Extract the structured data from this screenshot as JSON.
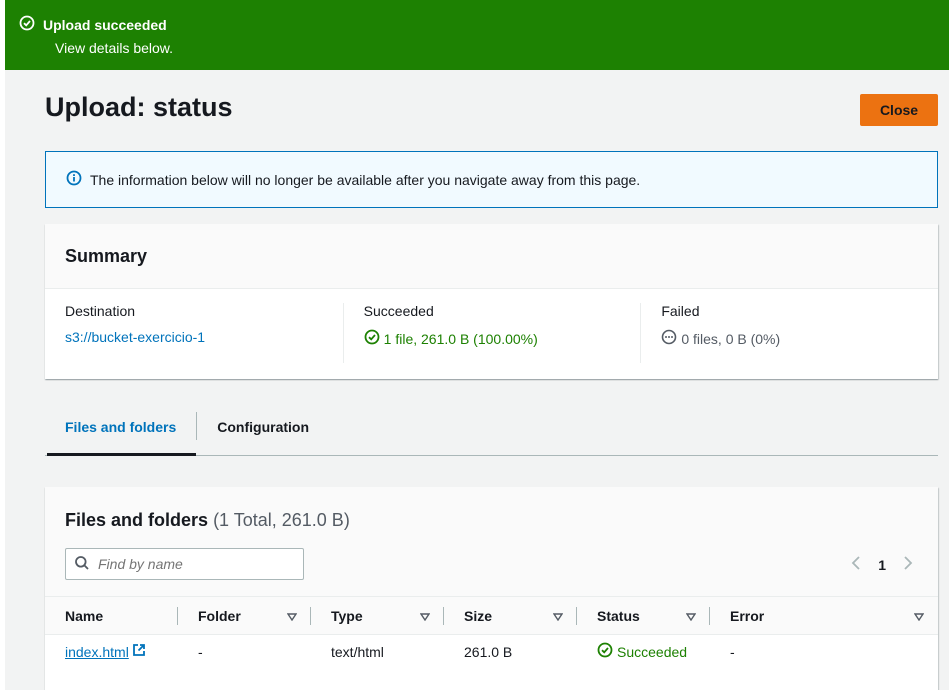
{
  "flash": {
    "title": "Upload succeeded",
    "subtitle": "View details below.",
    "color": "#1d8102"
  },
  "page": {
    "title": "Upload: status",
    "close_label": "Close"
  },
  "info_alert": {
    "text": "The information below will no longer be available after you navigate away from this page.",
    "icon": "info-icon"
  },
  "summary": {
    "title": "Summary",
    "destination": {
      "label": "Destination",
      "value": "s3://bucket-exercicio-1"
    },
    "succeeded": {
      "label": "Succeeded",
      "value": "1 file, 261.0 B (100.00%)",
      "icon": "check-circle-icon"
    },
    "failed": {
      "label": "Failed",
      "value": "0 files, 0 B (0%)",
      "icon": "ellipsis-circle-icon"
    }
  },
  "tabs": [
    {
      "label": "Files and folders",
      "active": true
    },
    {
      "label": "Configuration",
      "active": false
    }
  ],
  "files": {
    "title": "Files and folders",
    "count": "(1 Total, 261.0 B)",
    "search_placeholder": "Find by name",
    "page": "1",
    "columns": [
      "Name",
      "Folder",
      "Type",
      "Size",
      "Status",
      "Error"
    ],
    "rows": [
      {
        "name": "index.html",
        "folder": "-",
        "type": "text/html",
        "size": "261.0 B",
        "status": "Succeeded",
        "error": "-"
      }
    ]
  },
  "colors": {
    "accent": "#ec7211",
    "link": "#0073bb",
    "success": "#1d8102"
  }
}
